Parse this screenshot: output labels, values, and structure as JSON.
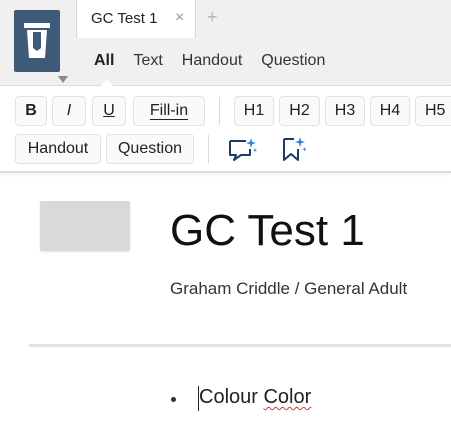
{
  "app": {
    "logo_icon": "trash-bin-logo-icon",
    "accent": "#3f5a78"
  },
  "tabs": {
    "active_title": "GC Test 1",
    "close_icon": "×",
    "add_icon": "+"
  },
  "subtabs": [
    {
      "label": "All",
      "active": true
    },
    {
      "label": "Text",
      "active": false
    },
    {
      "label": "Handout",
      "active": false
    },
    {
      "label": "Question",
      "active": false
    }
  ],
  "toolbar": {
    "bold": "B",
    "italic": "I",
    "underline": "U",
    "fillin": "Fill-in",
    "headings": [
      "H1",
      "H2",
      "H3",
      "H4",
      "H5"
    ],
    "handout": "Handout",
    "question": "Question",
    "ai_comment_icon": "sparkle-speech-bubble-icon",
    "ai_bookmark_icon": "sparkle-bookmark-icon"
  },
  "document": {
    "title": "GC Test 1",
    "subtitle": "Graham Criddle / General Adult",
    "bullet_word_1": "Colour",
    "bullet_word_2": "Color"
  }
}
